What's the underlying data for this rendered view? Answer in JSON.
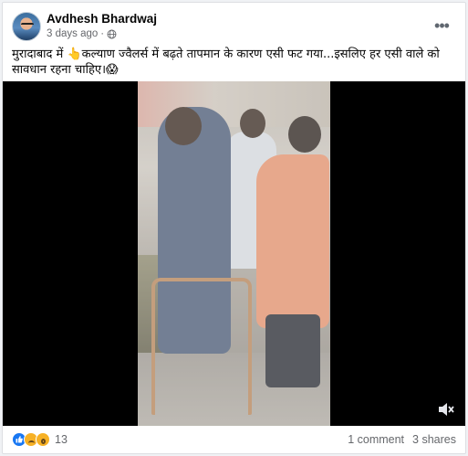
{
  "post": {
    "author": "Avdhesh Bhardwaj",
    "timestamp": "3 days ago",
    "timestamp_separator": "·",
    "privacy_icon": "globe-icon",
    "more_icon": "more-options-icon",
    "more_symbol": "•••",
    "caption": "मुरादाबाद में 👆कल्याण ज्वैलर्स में बढ़ते तापमान के कारण एसी फट गया...इसलिए हर एसी वाले को सावधान रहना चाहिए।😱"
  },
  "video": {
    "volume_icon": "volume-icon"
  },
  "footer": {
    "reactions": [
      "like",
      "sad",
      "wow"
    ],
    "reaction_count": "13",
    "comments": "1 comment",
    "shares": "3 shares"
  },
  "colors": {
    "accent": "#1877f2",
    "secondary_text": "#65676b",
    "video_bg": "#000000"
  }
}
